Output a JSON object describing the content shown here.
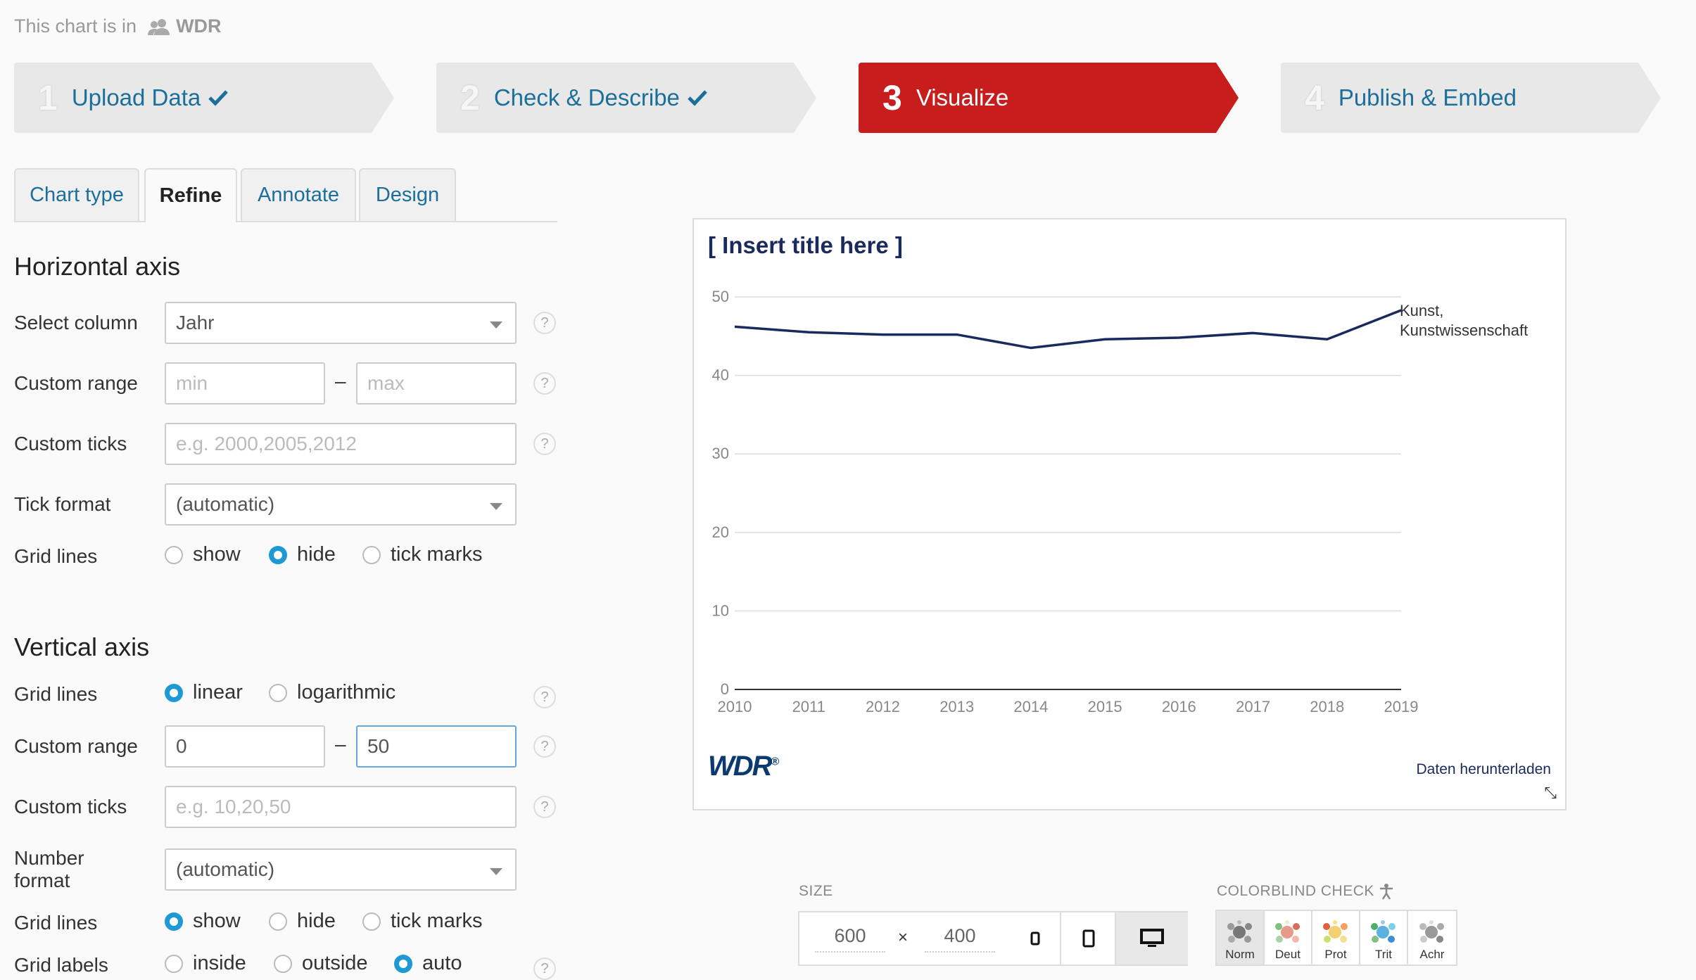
{
  "team": {
    "prefix": "This chart is in",
    "name": "WDR"
  },
  "steps": [
    {
      "num": "1",
      "label": "Upload Data",
      "done": true
    },
    {
      "num": "2",
      "label": "Check & Describe",
      "done": true
    },
    {
      "num": "3",
      "label": "Visualize",
      "done": false
    },
    {
      "num": "4",
      "label": "Publish & Embed",
      "done": false
    }
  ],
  "tabs": [
    "Chart type",
    "Refine",
    "Annotate",
    "Design"
  ],
  "horizontal": {
    "heading": "Horizontal axis",
    "select_column_label": "Select column",
    "select_column_value": "Jahr",
    "custom_range_label": "Custom range",
    "min_placeholder": "min",
    "max_placeholder": "max",
    "dash": "–",
    "custom_ticks_label": "Custom ticks",
    "custom_ticks_placeholder": "e.g. 2000,2005,2012",
    "tick_format_label": "Tick format",
    "tick_format_value": "(automatic)",
    "grid_lines_label": "Grid lines",
    "grid_options": [
      "show",
      "hide",
      "tick marks"
    ],
    "grid_selected": "hide"
  },
  "vertical": {
    "heading": "Vertical axis",
    "grid_lines_label": "Grid lines",
    "scale_options": [
      "linear",
      "logarithmic"
    ],
    "scale_selected": "linear",
    "custom_range_label": "Custom range",
    "range_min": "0",
    "range_max": "50",
    "dash": "–",
    "custom_ticks_label": "Custom ticks",
    "custom_ticks_placeholder": "e.g. 10,20,50",
    "number_format_label_1": "Number",
    "number_format_label_2": "format",
    "number_format_value": "(automatic)",
    "grid_lines_label2": "Grid lines",
    "grid_options": [
      "show",
      "hide",
      "tick marks"
    ],
    "grid_selected": "show",
    "grid_labels_label": "Grid labels",
    "label_options": [
      "inside",
      "outside",
      "auto"
    ],
    "label_selected": "auto"
  },
  "help": "?",
  "chart_data": {
    "type": "line",
    "title": "[ Insert title here ]",
    "x": [
      "2010",
      "2011",
      "2012",
      "2013",
      "2014",
      "2015",
      "2016",
      "2017",
      "2018",
      "2019"
    ],
    "series": [
      {
        "name": "Kunst, Kunstwissenschaft",
        "name_lines": [
          "Kunst,",
          "Kunstwissenschaft"
        ],
        "values": [
          46.2,
          45.5,
          45.2,
          45.2,
          43.5,
          44.6,
          44.8,
          45.4,
          44.6,
          48.3
        ],
        "color": "#1a2a5c"
      }
    ],
    "ylim": [
      0,
      50
    ],
    "yticks": [
      0,
      10,
      20,
      30,
      40,
      50
    ],
    "grid": true
  },
  "chart_footer": {
    "logo": "WDR",
    "logo_mark": "®",
    "download": "Daten herunterladen",
    "resize_icon": "⤡"
  },
  "size": {
    "label": "SIZE",
    "width": "600",
    "height": "400",
    "x": "×"
  },
  "colorblind": {
    "label": "COLORBLIND CHECK",
    "modes": [
      "Norm",
      "Deut",
      "Prot",
      "Trit",
      "Achr"
    ]
  },
  "colors": {
    "accent": "#c81d1d",
    "link": "#1c6f9b",
    "radio": "#1d9ad6",
    "line": "#1a2a5c"
  }
}
